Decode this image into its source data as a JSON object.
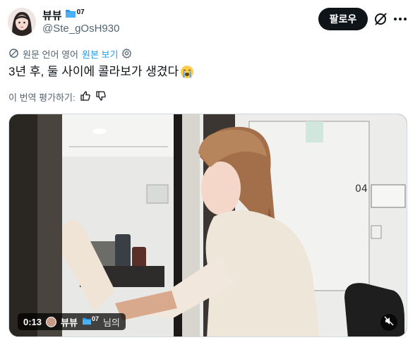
{
  "author": {
    "display_name": "뷰뷰",
    "badge_icon": "folder-icon",
    "badge_text": "07",
    "handle": "@Ste_gOsH930"
  },
  "header": {
    "follow_label": "팔로우",
    "grok_icon": "grok-icon",
    "more_icon": "more-icon"
  },
  "translation": {
    "source_label": "원문 언어 영어",
    "view_original_label": "원본 보기",
    "settings_icon": "gear-icon"
  },
  "tweet": {
    "text": "3년 후, 둘 사이에 콜라보가 생겼다",
    "emoji": "loudly-crying-face"
  },
  "rate_translation": {
    "label": "이 번역 평가하기:",
    "like_icon": "thumbs-up-icon",
    "dislike_icon": "thumbs-down-icon"
  },
  "video": {
    "time": "0:13",
    "overlay_name": "뷰뷰",
    "overlay_badge_text": "07",
    "overlay_suffix": "님의",
    "mute_icon": "muted-speaker-icon",
    "accent_colors": {
      "follow_bg": "#0f1419",
      "link": "#1d9bf0",
      "muted_text": "#536471"
    }
  }
}
